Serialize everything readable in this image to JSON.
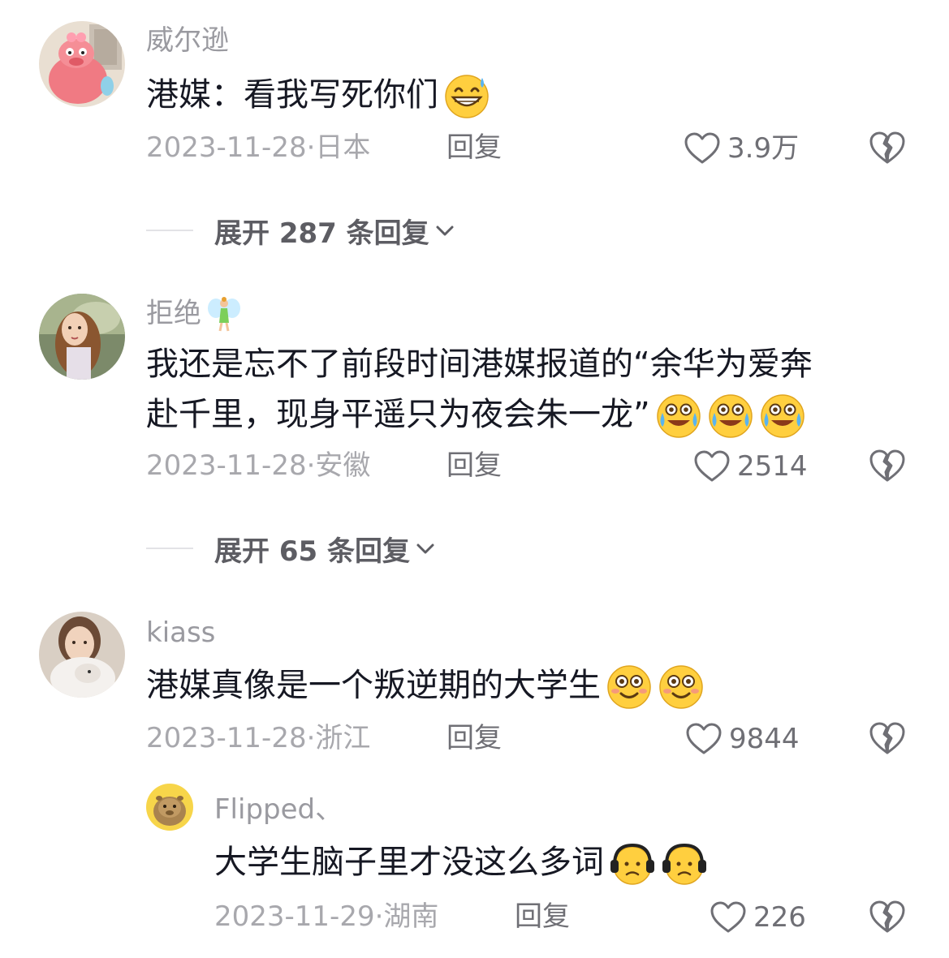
{
  "comments": [
    {
      "username": "威尔逊",
      "text": "港媒：看我写死你们",
      "date": "2023-11-28",
      "location": "日本",
      "reply_label": "回复",
      "likes": "3.9万",
      "expand_label": "展开 287 条回复",
      "emojis": [
        "grin-sweat-emoji"
      ]
    },
    {
      "username": "拒绝",
      "name_decoration": "fairy-emoji",
      "text_line1": "我还是忘不了前段时间港媒报道的“余华为爱奔",
      "text_line2": "赴千里，现身平遥只为夜会朱一龙”",
      "date": "2023-11-28",
      "location": "安徽",
      "reply_label": "回复",
      "likes": "2514",
      "expand_label": "展开 65 条回复",
      "emojis": [
        "laugh-cry-emoji",
        "laugh-cry-emoji",
        "laugh-cry-emoji"
      ]
    },
    {
      "username": "kiass",
      "text": "港媒真像是一个叛逆期的大学生",
      "date": "2023-11-28",
      "location": "浙江",
      "reply_label": "回复",
      "likes": "9844",
      "emojis": [
        "smile-emoji",
        "smile-emoji"
      ]
    }
  ],
  "reply": {
    "username": "Flipped、",
    "text": "大学生脑子里才没这么多词",
    "date": "2023-11-29",
    "location": "湖南",
    "reply_label": "回复",
    "likes": "226",
    "emojis": [
      "headphone-emoji",
      "headphone-emoji"
    ]
  },
  "meta_separator": "·",
  "colors": {
    "text": "#161823",
    "meta": "#a8a8ad",
    "action": "#6f6f75",
    "emoji_yellow": "#ffcf3f"
  }
}
